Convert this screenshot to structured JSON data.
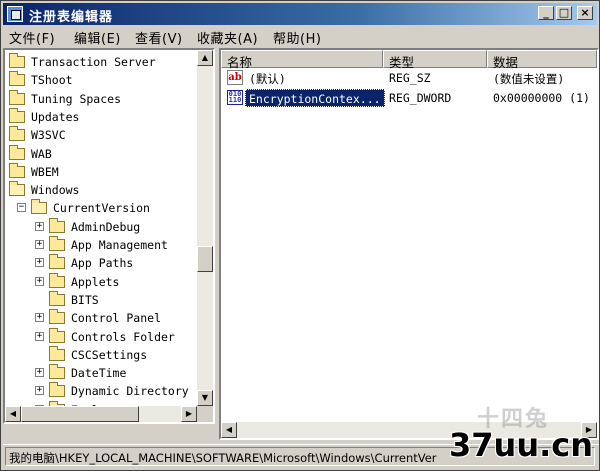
{
  "window": {
    "title": "注册表编辑器",
    "minimize": "_",
    "maximize": "□",
    "close": "×"
  },
  "menu": [
    {
      "label": "文件(F)"
    },
    {
      "label": "编辑(E)"
    },
    {
      "label": "查看(V)"
    },
    {
      "label": "收藏夹(A)"
    },
    {
      "label": "帮助(H)"
    }
  ],
  "tree": [
    {
      "label": "Transaction Server",
      "depth": 0,
      "expander": "",
      "open": false
    },
    {
      "label": "TShoot",
      "depth": 0,
      "expander": "",
      "open": false
    },
    {
      "label": "Tuning Spaces",
      "depth": 0,
      "expander": "",
      "open": false
    },
    {
      "label": "Updates",
      "depth": 0,
      "expander": "",
      "open": false
    },
    {
      "label": "W3SVC",
      "depth": 0,
      "expander": "",
      "open": false
    },
    {
      "label": "WAB",
      "depth": 0,
      "expander": "",
      "open": false
    },
    {
      "label": "WBEM",
      "depth": 0,
      "expander": "",
      "open": false
    },
    {
      "label": "Windows",
      "depth": 0,
      "expander": "",
      "open": true
    },
    {
      "label": "CurrentVersion",
      "depth": 1,
      "expander": "−",
      "open": true
    },
    {
      "label": "AdminDebug",
      "depth": 2,
      "expander": "+",
      "open": false
    },
    {
      "label": "App Management",
      "depth": 2,
      "expander": "+",
      "open": false
    },
    {
      "label": "App Paths",
      "depth": 2,
      "expander": "+",
      "open": false
    },
    {
      "label": "Applets",
      "depth": 2,
      "expander": "+",
      "open": false
    },
    {
      "label": "BITS",
      "depth": 2,
      "expander": "",
      "open": false
    },
    {
      "label": "Control Panel",
      "depth": 2,
      "expander": "+",
      "open": false
    },
    {
      "label": "Controls Folder",
      "depth": 2,
      "expander": "+",
      "open": false
    },
    {
      "label": "CSCSettings",
      "depth": 2,
      "expander": "",
      "open": false
    },
    {
      "label": "DateTime",
      "depth": 2,
      "expander": "+",
      "open": false
    },
    {
      "label": "Dynamic Directory",
      "depth": 2,
      "expander": "+",
      "open": false
    },
    {
      "label": "Explorer",
      "depth": 2,
      "expander": "−",
      "open": true
    }
  ],
  "list": {
    "columns": [
      "名称",
      "类型",
      "数据"
    ],
    "rows": [
      {
        "icon": "string-value-icon",
        "icon_text": "ab",
        "name": "(默认)",
        "type": "REG_SZ",
        "data": "(数值未设置)",
        "selected": false
      },
      {
        "icon": "binary-value-icon",
        "icon_text": "010 110",
        "name": "EncryptionContex...",
        "type": "REG_DWORD",
        "data": "0x00000000 (1)",
        "selected": true
      }
    ]
  },
  "status": {
    "path": "我的电脑\\HKEY_LOCAL_MACHINE\\SOFTWARE\\Microsoft\\Windows\\CurrentVer"
  },
  "watermark": {
    "logo": "37uu.cn",
    "faint": "十四兔"
  },
  "colors": {
    "title_start": "#0a246a",
    "title_end": "#a6caf0",
    "selection": "#0a246a",
    "face": "#d4d0c8"
  }
}
